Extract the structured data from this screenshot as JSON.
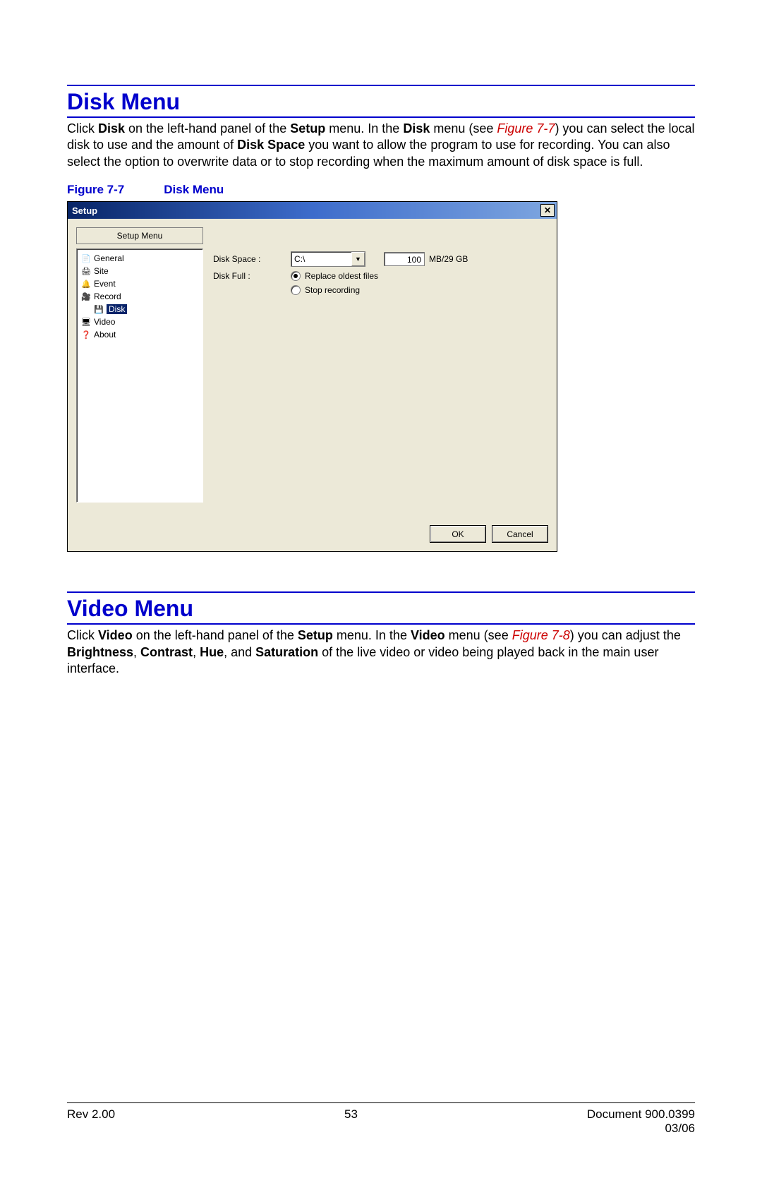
{
  "section1": {
    "title": "Disk Menu",
    "para_before_bold1": "Click ",
    "bold1": "Disk",
    "mid1": " on the left-hand panel of the ",
    "bold2": "Setup",
    "mid2": " menu. In the ",
    "bold3": "Disk",
    "mid3": " menu (see ",
    "figref": "Figure 7-7",
    "mid4": ") you can select the local disk to use and the amount of ",
    "bold4": "Disk Space",
    "tail": " you want to allow the program to use for recording. You can also select the option to overwrite data or to stop recording when the maximum amount of disk space is full."
  },
  "figure": {
    "prefix": "Figure 7-7",
    "title": "Disk Menu"
  },
  "dialog": {
    "title": "Setup",
    "close_glyph": "✕",
    "setup_menu_label": "Setup Menu",
    "tree": {
      "items": [
        {
          "icon": "📄",
          "label": "General",
          "selected": false,
          "child": false
        },
        {
          "icon": "🖨",
          "label": "Site",
          "selected": false,
          "child": false
        },
        {
          "icon": "🔔",
          "label": "Event",
          "selected": false,
          "child": false
        },
        {
          "icon": "🎥",
          "label": "Record",
          "selected": false,
          "child": false
        },
        {
          "icon": "💾",
          "label": "Disk",
          "selected": true,
          "child": true
        },
        {
          "icon": "🖥",
          "label": "Video",
          "selected": false,
          "child": false
        },
        {
          "icon": "❓",
          "label": "About",
          "selected": false,
          "child": false
        }
      ]
    },
    "disk_space_label": "Disk Space :",
    "disk_space_value": "C:\\",
    "disk_space_number": "100",
    "disk_space_unit": "MB/29 GB",
    "disk_full_label": "Disk Full :",
    "radio1": "Replace oldest files",
    "radio2": "Stop recording",
    "ok": "OK",
    "cancel": "Cancel"
  },
  "section2": {
    "title": "Video Menu",
    "pre": "Click ",
    "b1": "Video",
    "m1": " on the left-hand panel of the ",
    "b2": "Setup",
    "m2": " menu. In the ",
    "b3": "Video",
    "m3": " menu (see ",
    "figref": "Figure 7-8",
    "m4": ") you can adjust the ",
    "b4": "Brightness",
    "c1": ", ",
    "b5": "Contrast",
    "c2": ", ",
    "b6": "Hue",
    "c3": ", and ",
    "b7": "Saturation",
    "tail": " of the live video or video being played back in the main user interface."
  },
  "footer": {
    "rev": "Rev 2.00",
    "page": "53",
    "doc": "Document 900.0399",
    "date": "03/06"
  }
}
